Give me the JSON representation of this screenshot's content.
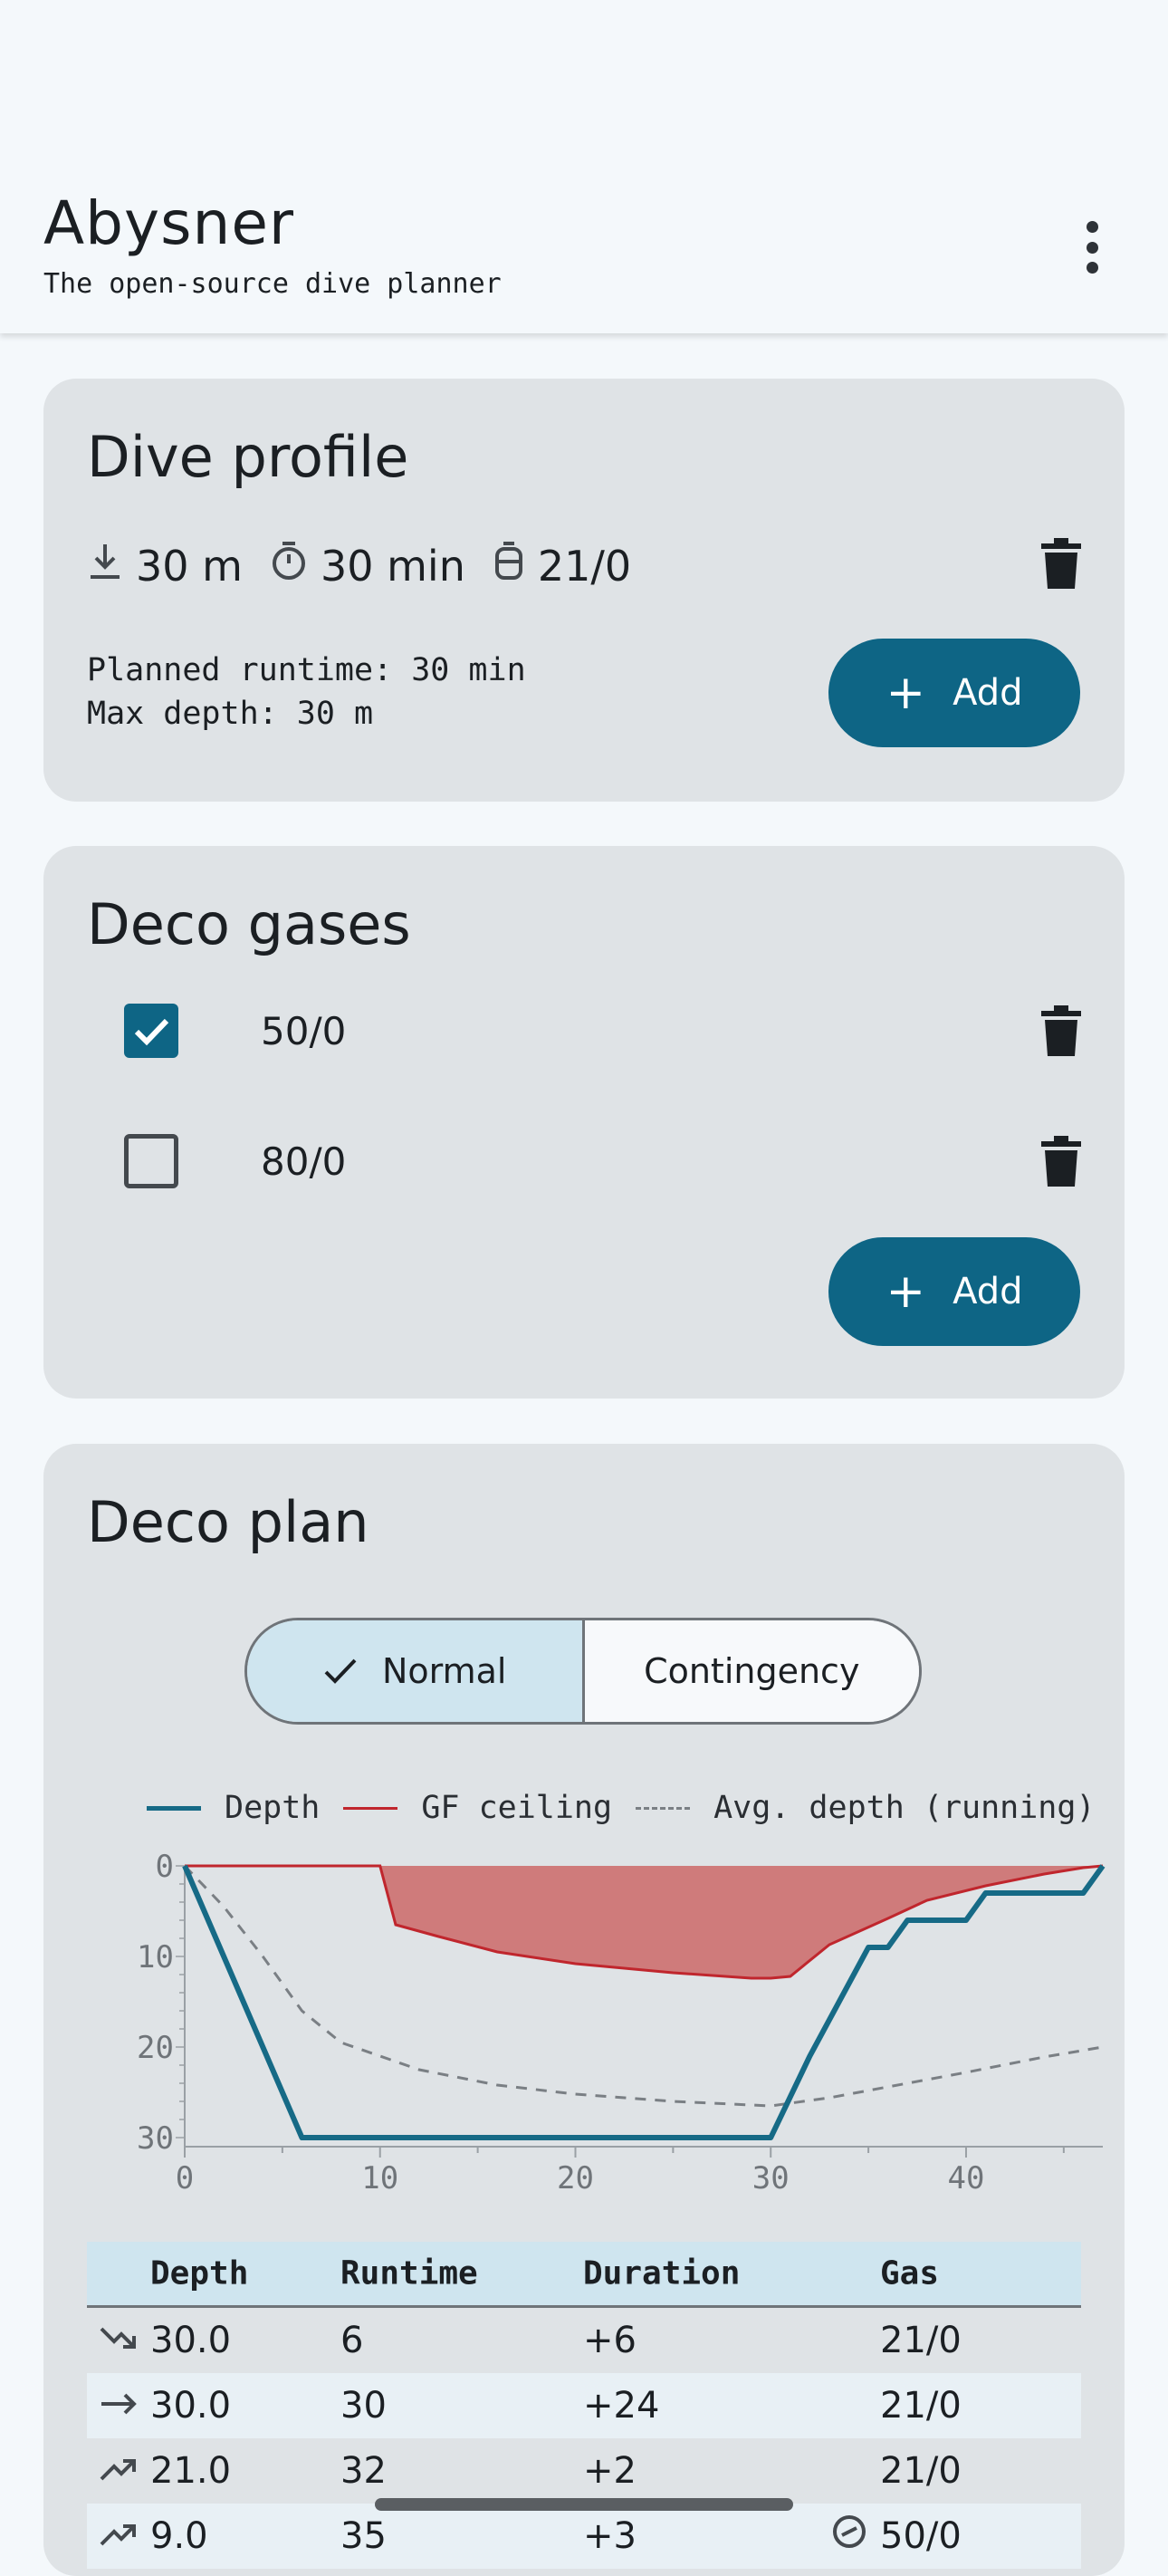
{
  "app": {
    "title": "Abysner",
    "subtitle": "The open-source dive planner",
    "menu_icon": "more-vert-icon"
  },
  "dive_profile": {
    "title": "Dive profile",
    "depth": "30 m",
    "duration": "30 min",
    "gas": "21/0",
    "planned_runtime": "Planned runtime: 30 min",
    "max_depth": "Max depth: 30 m",
    "add_label": "Add"
  },
  "deco_gases": {
    "title": "Deco gases",
    "items": [
      {
        "label": "50/0",
        "checked": true
      },
      {
        "label": "80/0",
        "checked": false
      }
    ],
    "add_label": "Add"
  },
  "deco_plan": {
    "title": "Deco plan",
    "modes": [
      {
        "label": "Normal",
        "selected": true
      },
      {
        "label": "Contingency",
        "selected": false
      }
    ],
    "legend": [
      "Depth",
      "GF ceiling",
      "Avg. depth (running)"
    ],
    "colors": {
      "depth": "#166a86",
      "ceiling": "#c0262d",
      "ceiling_fill": "#cf7b7b",
      "avg": "#7a7f84"
    }
  },
  "chart_data": {
    "type": "line",
    "x_ticks": [
      "0",
      "10",
      "20",
      "30",
      "40"
    ],
    "y_ticks": [
      "0",
      "10",
      "20",
      "30"
    ],
    "xlim": [
      0,
      47
    ],
    "ylim": [
      0,
      31
    ],
    "y_inverted": true,
    "series": [
      {
        "name": "Depth",
        "points": [
          [
            0,
            0
          ],
          [
            6,
            30
          ],
          [
            30,
            30
          ],
          [
            32,
            21
          ],
          [
            35,
            9
          ],
          [
            36,
            9
          ],
          [
            37,
            6
          ],
          [
            40,
            6
          ],
          [
            41,
            3
          ],
          [
            46,
            3
          ],
          [
            47,
            0
          ]
        ]
      },
      {
        "name": "GF ceiling",
        "points": [
          [
            0,
            0
          ],
          [
            10,
            0
          ],
          [
            10.8,
            6.5
          ],
          [
            13,
            7.8
          ],
          [
            16,
            9.5
          ],
          [
            20,
            10.8
          ],
          [
            25,
            11.8
          ],
          [
            29,
            12.4
          ],
          [
            30,
            12.4
          ],
          [
            31,
            12.2
          ],
          [
            33,
            8.7
          ],
          [
            36,
            5.8
          ],
          [
            38,
            3.8
          ],
          [
            41,
            2.2
          ],
          [
            44,
            0.9
          ],
          [
            46,
            0.2
          ],
          [
            47,
            0
          ]
        ]
      },
      {
        "name": "Avg. depth (running)",
        "points": [
          [
            0,
            0
          ],
          [
            2,
            4.5
          ],
          [
            4,
            10
          ],
          [
            6,
            16
          ],
          [
            8,
            19.5
          ],
          [
            12,
            22.5
          ],
          [
            16,
            24.2
          ],
          [
            20,
            25.2
          ],
          [
            25,
            26
          ],
          [
            30,
            26.5
          ],
          [
            33,
            25.6
          ],
          [
            36,
            24.4
          ],
          [
            40,
            22.8
          ],
          [
            44,
            21.1
          ],
          [
            47,
            20
          ]
        ]
      }
    ]
  },
  "table": {
    "headers": [
      "Depth",
      "Runtime",
      "Duration",
      "Gas"
    ],
    "rows": [
      {
        "icon": "trending-down-icon",
        "depth": "30.0",
        "runtime": "6",
        "duration": "+6",
        "gas": "21/0"
      },
      {
        "icon": "arrow-right-icon",
        "depth": "30.0",
        "runtime": "30",
        "duration": "+24",
        "gas": "21/0"
      },
      {
        "icon": "trending-up-icon",
        "depth": "21.0",
        "runtime": "32",
        "duration": "+2",
        "gas": "21/0"
      },
      {
        "icon": "trending-up-icon",
        "depth": "9.0",
        "runtime": "35",
        "duration": "+3",
        "gas": "50/0",
        "gas_icon": "gas-switch-icon"
      }
    ]
  }
}
